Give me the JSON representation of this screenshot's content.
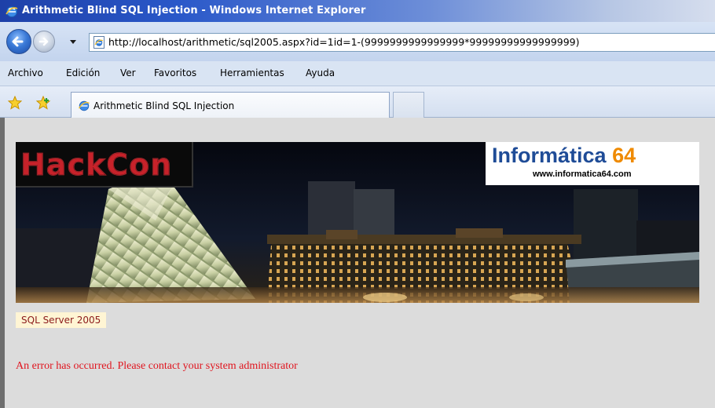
{
  "window": {
    "title": "Arithmetic Blind SQL Injection - Windows Internet Explorer"
  },
  "address_bar": {
    "url": "http://localhost/arithmetic/sql2005.aspx?id=1id=1-(9999999999999999*99999999999999999)"
  },
  "menu": {
    "items": [
      {
        "label": "Archivo"
      },
      {
        "label": "Edición"
      },
      {
        "label": "Ver"
      },
      {
        "label": "Favoritos"
      },
      {
        "label": "Herramientas"
      },
      {
        "label": "Ayuda"
      }
    ]
  },
  "tabs": {
    "active_label": "Arithmetic Blind SQL Injection"
  },
  "page": {
    "banner": {
      "left_logo": "HackCon",
      "right_logo_main": "Informática",
      "right_logo_number": "64",
      "right_logo_url": "www.informatica64.com"
    },
    "server_label": "SQL Server 2005",
    "error_message": "An error has occurred. Please contact your system administrator"
  },
  "icons": {
    "title": "ie-icon",
    "back": "back-arrow-icon",
    "forward": "forward-arrow-icon",
    "dropdown": "chevron-down-icon",
    "page": "ie-page-icon",
    "favorites": "favorites-star-icon",
    "add_favorites": "add-favorites-icon",
    "tab": "ie-icon"
  },
  "colors": {
    "title_bar": "#2a58c9",
    "error_text": "#e0141e",
    "badge_bg": "#fff5d4",
    "brand_blue": "#1f4c97",
    "brand_orange": "#ef8a00"
  }
}
